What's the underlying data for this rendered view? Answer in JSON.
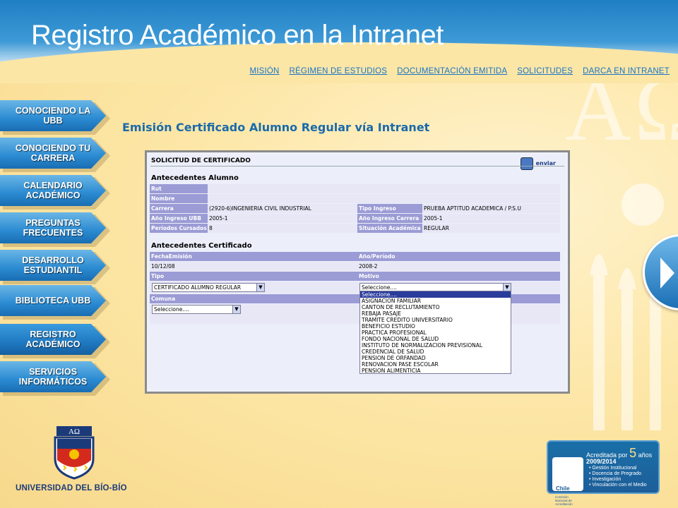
{
  "header": {
    "title": "Registro Académico en la Intranet",
    "nav": [
      "MISIÓN",
      "RÉGIMEN DE ESTUDIOS",
      "DOCUMENTACIÓN EMITIDA",
      "SOLICITUDES",
      "DARCA EN INTRANET"
    ]
  },
  "sidebar": {
    "items": [
      {
        "label": "CONOCIENDO LA UBB"
      },
      {
        "label": "CONOCIENDO TU CARRERA"
      },
      {
        "label": "CALENDARIO ACADÉMICO"
      },
      {
        "label": "PREGUNTAS FRECUENTES"
      },
      {
        "label": "DESARROLLO ESTUDIANTIL"
      },
      {
        "label": "BIBLIOTECA UBB"
      },
      {
        "label": "REGISTRO ACADÉMICO"
      },
      {
        "label": "SERVICIOS INFORMÁTICOS"
      }
    ]
  },
  "main": {
    "heading": "Emisión Certificado Alumno Regular vía Intranet"
  },
  "form": {
    "title": "SOLICITUD DE CERTIFICADO",
    "send_label": "enviar",
    "student_section": "Antecedentes Alumno",
    "labels": {
      "rut": "Rut",
      "nombre": "Nombre",
      "carrera": "Carrera",
      "tipo_ingreso": "Tipo Ingreso",
      "anio_ingreso_ubb": "Año Ingreso UBB",
      "anio_ingreso_carrera": "Año Ingreso Carrera",
      "periodos": "Períodos Cursados",
      "situacion": "Situación Académica"
    },
    "values": {
      "carrera": "(2920-6)INGENIERIA CIVIL INDUSTRIAL",
      "tipo_ingreso": "PRUEBA APTITUD ACADEMICA / P.S.U",
      "anio_ingreso_ubb": "2005-1",
      "anio_ingreso_carrera": "2005-1",
      "periodos": "8",
      "situacion": "REGULAR"
    },
    "cert_section": "Antecedentes Certificado",
    "cert_labels": {
      "fecha": "FechaEmisión",
      "anio_periodo": "Año/Período",
      "tipo": "Tipo",
      "motivo": "Motivo",
      "comuna": "Comuna"
    },
    "cert_values": {
      "fecha": "10/12/08",
      "anio_periodo": "2008-2"
    },
    "tipo_select": "CERTIFICADO ALUMNO REGULAR",
    "motivo_select": "Seleccione....",
    "comuna_select": "Seleccione....",
    "motivo_options": [
      "Seleccione....",
      "ASIGNACION FAMILIAR",
      "CANTON DE RECLUTAMIENTO",
      "REBAJA PASAJE",
      "TRAMITE CREDITO UNIVERSITARIO",
      "BENEFICIO ESTUDIO",
      "PRACTICA PROFESIONAL",
      "FONDO NACIONAL DE SALUD",
      "INSTITUTO DE NORMALIZACION PREVISIONAL",
      "CREDENCIAL DE SALUD",
      "PENSION DE ORFANDAD",
      "RENOVACION PASE ESCOLAR",
      "PENSION ALIMENTICIA"
    ]
  },
  "footer": {
    "university": "UNIVERSIDAD DEL BÍO-BÍO",
    "accreditation": {
      "head": "Acreditada por",
      "years_number": "5",
      "years_word": "años",
      "period": "2009/2014",
      "agency": "Chile",
      "agency_sub": "Comisión Nacional de Acreditación",
      "items": [
        "• Gestión Institucional",
        "• Docencia de Pregrado",
        "• Investigación",
        "• Vinculación con el Medio"
      ]
    }
  }
}
